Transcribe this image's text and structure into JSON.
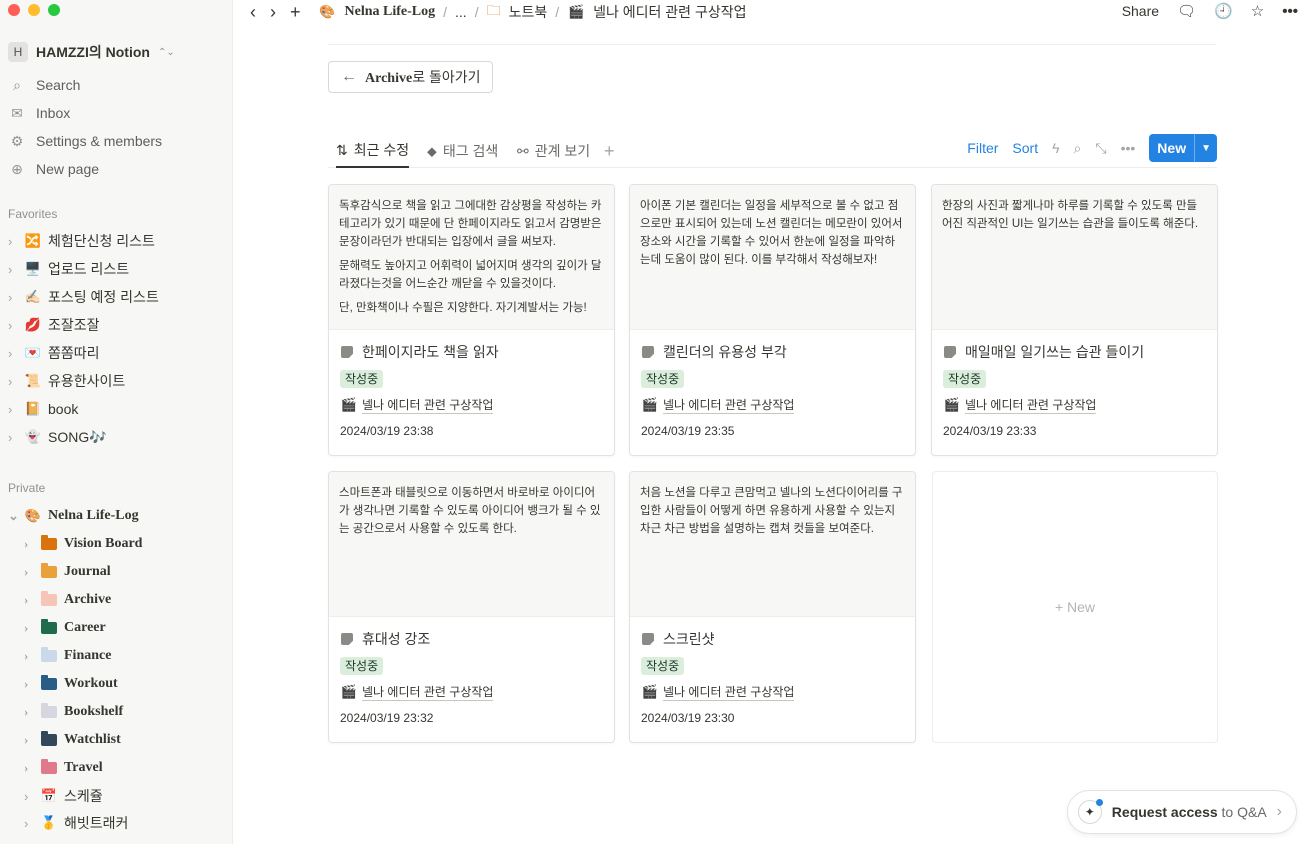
{
  "window": {
    "controls": [
      "close",
      "minimize",
      "zoom"
    ],
    "colors": [
      "#ff5f57",
      "#febc2e",
      "#28c840"
    ]
  },
  "sidebar": {
    "workspace": {
      "initial": "H",
      "name": "HAMZZI의 Notion"
    },
    "top_items": [
      {
        "label": "Search",
        "icon": "search-icon"
      },
      {
        "label": "Inbox",
        "icon": "inbox-icon"
      },
      {
        "label": "Settings & members",
        "icon": "gear-icon"
      },
      {
        "label": "New page",
        "icon": "plus-circle-icon"
      }
    ],
    "favorites_label": "Favorites",
    "favorites": [
      {
        "label": "체험단신청 리스트",
        "emoji": "🔀"
      },
      {
        "label": "업로드 리스트",
        "emoji": "🖥️"
      },
      {
        "label": "포스팅 예정 리스트",
        "emoji": "✍🏻"
      },
      {
        "label": "조잘조잘",
        "emoji": "💋"
      },
      {
        "label": "쫌쫌따리",
        "emoji": "💌"
      },
      {
        "label": "유용한사이트",
        "emoji": "📜"
      },
      {
        "label": "book",
        "emoji": "📔"
      },
      {
        "label": "SONG🎶",
        "emoji": "👻"
      }
    ],
    "private_label": "Private",
    "private_root": {
      "label": "Nelna Life-Log",
      "emoji": "🎨"
    },
    "private_children": [
      {
        "label": "Vision Board",
        "color": "#d9730d"
      },
      {
        "label": "Journal",
        "color": "#e9a23b"
      },
      {
        "label": "Archive",
        "color": "#f5c6b8"
      },
      {
        "label": "Career",
        "color": "#1f6b4b"
      },
      {
        "label": "Finance",
        "color": "#c9d9e8"
      },
      {
        "label": "Workout",
        "color": "#2a5d86"
      },
      {
        "label": "Bookshelf",
        "color": "#d6d6e0"
      },
      {
        "label": "Watchlist",
        "color": "#33475b"
      },
      {
        "label": "Travel",
        "color": "#e07a8a"
      },
      {
        "label": "스케쥴",
        "emoji": "📅"
      },
      {
        "label": "해빗트래커",
        "emoji": "🥇"
      }
    ]
  },
  "topbar": {
    "breadcrumbs": [
      {
        "label": "Nelna Life-Log",
        "emoji": "🎨"
      },
      {
        "label": "..."
      },
      {
        "label": "노트북",
        "icon": "folder-icon"
      },
      {
        "label": "넬나 에디터 관련 구상작업",
        "emoji": "🎬"
      }
    ],
    "share_label": "Share"
  },
  "main": {
    "back_button": {
      "label_bold": "Archive",
      "label_rest": "로 돌아가기"
    },
    "tabs": [
      {
        "label": "최근 수정",
        "icon": "sort-icon",
        "active": true
      },
      {
        "label": "태그 검색",
        "icon": "tag-icon",
        "active": false
      },
      {
        "label": "관계 보기",
        "icon": "relation-icon",
        "active": false
      }
    ],
    "tools": {
      "filter": "Filter",
      "sort": "Sort",
      "new": "New"
    },
    "cards": [
      {
        "preview": [
          "독후감식으로 책을 읽고 그에대한 감상평을 작성하는 카테고리가 있기 때문에 단 한페이지라도 읽고서 감명받은 문장이라던가 반대되는 입장에서 글을 써보자.",
          "문해력도 높아지고 어휘력이 넓어지며 생각의 깊이가 달라졌다는것을 어느순간 깨닫을 수 있을것이다.",
          "단, 만화책이나 수필은 지양한다. 자기계발서는 가능!"
        ],
        "title": "한페이지라도 책을 읽자",
        "tag": "작성중",
        "relation": "넬나 에디터 관련 구상작업",
        "date": "2024/03/19 23:38"
      },
      {
        "preview": [
          "아이폰 기본 캘린더는 일정을 세부적으로 볼 수 없고 점으로만 표시되어 있는데 노션 캘린더는 메모란이 있어서 장소와 시간을 기록할 수 있어서 한눈에 일정을 파악하는데 도움이 많이 된다. 이를 부각해서 작성해보자!"
        ],
        "title": "캘린더의 유용성 부각",
        "tag": "작성중",
        "relation": "넬나 에디터 관련 구상작업",
        "date": "2024/03/19 23:35"
      },
      {
        "preview": [
          "한장의 사진과 짧게나마 하루를 기록할 수 있도록 만들어진 직관적인 UI는 일기쓰는 습관을 들이도록 해준다."
        ],
        "title": "매일매일 일기쓰는 습관 들이기",
        "tag": "작성중",
        "relation": "넬나 에디터 관련 구상작업",
        "date": "2024/03/19 23:33"
      },
      {
        "preview": [
          "스마트폰과 태블릿으로 이동하면서 바로바로 아이디어가 생각나면 기록할 수 있도록 아이디어 뱅크가 될 수 있는 공간으로서 사용할 수 있도록 한다."
        ],
        "title": "휴대성 강조",
        "tag": "작성중",
        "relation": "넬나 에디터 관련 구상작업",
        "date": "2024/03/19 23:32"
      },
      {
        "preview": [
          "처음 노션을 다루고 큰맘먹고 넬나의 노션다이어리를 구입한 사람들이 어떻게 하면 유용하게 사용할 수 있는지 차근 차근 방법을 설명하는 캡쳐 컷들을 보여준다."
        ],
        "title": "스크린샷",
        "tag": "작성중",
        "relation": "넬나 에디터 관련 구상작업",
        "date": "2024/03/19 23:30"
      }
    ],
    "new_card_label": "+ New"
  },
  "qa": {
    "bold": "Request access",
    "rest": " to Q&A"
  },
  "colors": {
    "accent": "#2383e2",
    "tag_bg": "#dbeddb",
    "sidebar_bg": "#f7f7f5"
  }
}
